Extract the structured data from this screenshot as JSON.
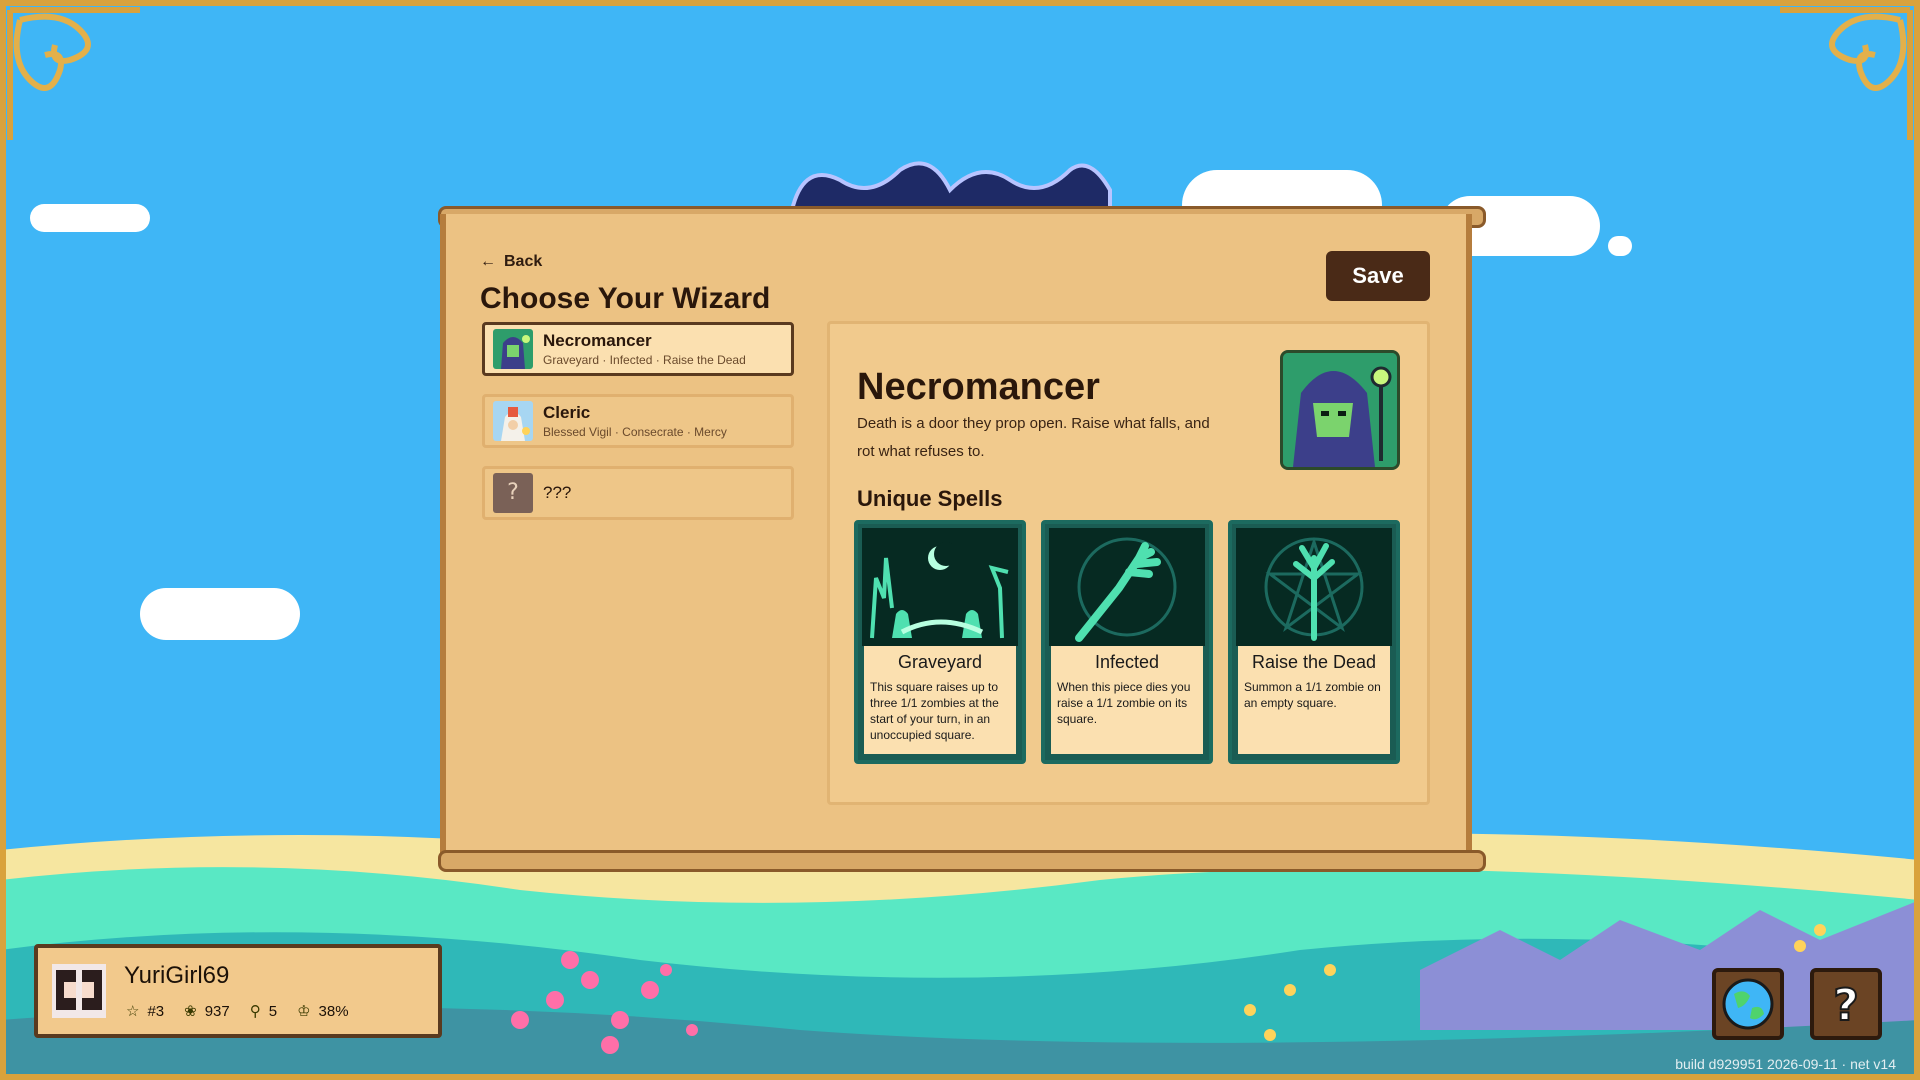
{
  "header": {
    "back_label": "Back",
    "title": "Choose Your Wizard",
    "save_label": "Save"
  },
  "wizards": [
    {
      "name": "Necromancer",
      "spells": "Graveyard · Infected · Raise the Dead",
      "icon": "necromancer-icon",
      "selected": true
    },
    {
      "name": "Cleric",
      "spells": "Blessed Vigil · Consecrate · Mercy",
      "icon": "cleric-icon",
      "selected": false
    },
    {
      "name": "???",
      "spells": "",
      "icon": "question-icon",
      "selected": false
    }
  ],
  "detail": {
    "name": "Necromancer",
    "description": "Death is a door they prop open. Raise what falls, and rot what refuses to.",
    "spells_heading": "Unique Spells",
    "spells": [
      {
        "name": "Graveyard",
        "text": "This square raises up to three 1/1 zombies at the start of your turn, in an unoccupied square."
      },
      {
        "name": "Infected",
        "text": "When this piece dies you raise a 1/1 zombie on its square."
      },
      {
        "name": "Raise the Dead",
        "text": "Summon a 1/1 zombie on an empty square."
      }
    ]
  },
  "player": {
    "name": "YuriGirl69",
    "rank": "#3",
    "rating": "937",
    "trophies": "5",
    "win_rate": "38%"
  },
  "footer": {
    "build": "build d929951 2026-09-11 · net v14"
  },
  "colors": {
    "sky": "#3fb6f6",
    "panel": "#ecc283",
    "save_button": "#4a2a17",
    "card_frame": "#1c6a5f",
    "spell_glow": "#4fe0b0"
  }
}
